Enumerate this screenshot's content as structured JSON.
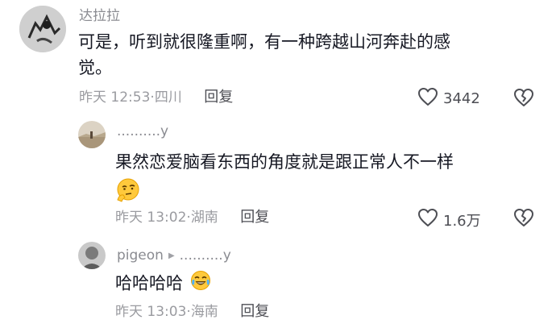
{
  "comments": [
    {
      "username": "达拉拉",
      "text_line1": "可是，听到就很隆重啊，有一种跨越山河奔赴的感",
      "text_line2": "觉。",
      "time": "昨天 12:53",
      "location": "四川",
      "reply_label": "回复",
      "likes": "3442"
    },
    {
      "username": "..........y",
      "text": "果然恋爱脑看东西的角度就是跟正常人不一样",
      "time": "昨天 13:02",
      "location": "湖南",
      "reply_label": "回复",
      "likes": "1.6万"
    },
    {
      "username": "pigeon",
      "reply_to": "..........y",
      "text": "哈哈哈哈",
      "time": "昨天 13:03",
      "location": "海南",
      "reply_label": "回复"
    }
  ],
  "icons": {
    "like": "heart-outline-icon",
    "dislike": "broken-heart-icon",
    "reply_arrow": "play-triangle-icon"
  },
  "colors": {
    "text": "#161823",
    "secondary": "#8a8b91",
    "meta": "#9a9ba0"
  }
}
